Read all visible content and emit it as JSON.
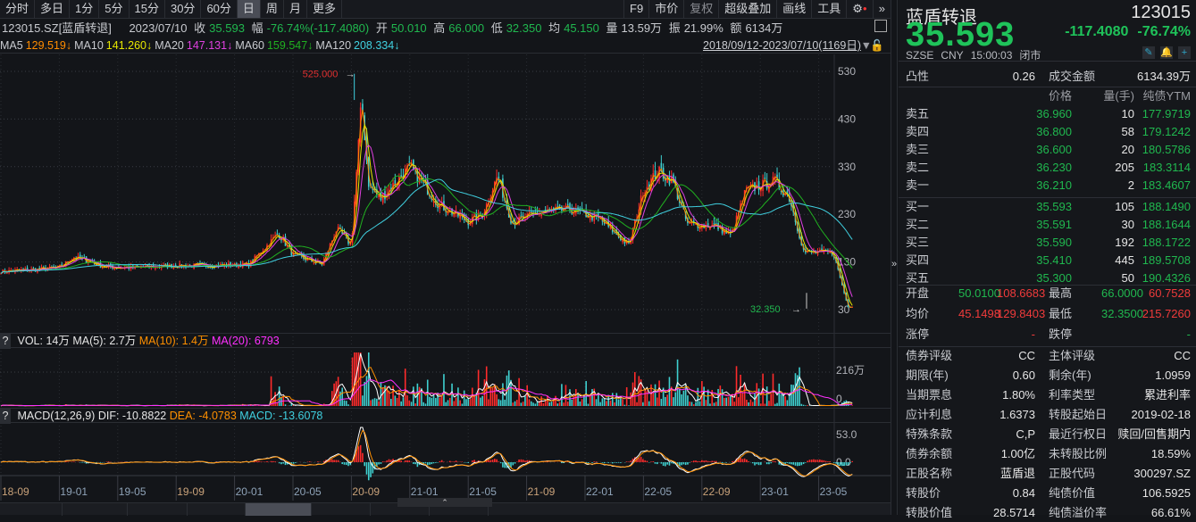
{
  "toolbar": {
    "periods": [
      "分时",
      "多日",
      "1分",
      "5分",
      "15分",
      "30分",
      "60分",
      "日",
      "周",
      "月",
      "更多"
    ],
    "active": "日",
    "right": [
      "F9",
      "市价",
      "复权",
      "超级叠加",
      "画线",
      "工具"
    ]
  },
  "info": {
    "code_name": "123015.SZ[蓝盾转退]",
    "date": "2023/07/10",
    "close_label": "收",
    "close": "35.593",
    "amp_label": "幅",
    "change": "-76.74%(-117.4080)",
    "open_label": "开",
    "open": "50.010",
    "high_label": "高",
    "high": "66.000",
    "low_label": "低",
    "low": "32.350",
    "avg_label": "均",
    "avg": "45.150",
    "vol_label": "量",
    "vol": "13.59万",
    "swing_label": "振",
    "swing": "21.99%",
    "amt_label": "额",
    "amt": "6134万"
  },
  "ma": [
    {
      "label": "MA5",
      "value": "129.519↓",
      "color": "#ff8c00"
    },
    {
      "label": "MA10",
      "value": "141.260↓",
      "color": "#e6e600"
    },
    {
      "label": "MA20",
      "value": "147.131↓",
      "color": "#e040e0"
    },
    {
      "label": "MA60",
      "value": "159.547↓",
      "color": "#20b020"
    },
    {
      "label": "MA120",
      "value": "208.334↓",
      "color": "#40d0e0"
    }
  ],
  "range": "2018/09/12-2023/07/10(1169日)",
  "chart_data": {
    "type": "candlestick",
    "price_axis": {
      "ticks": [
        "530",
        "430",
        "330",
        "230",
        "130",
        "30"
      ],
      "range": [
        0,
        560
      ]
    },
    "max_label": "525.000",
    "min_label": "32.350",
    "close_path": [
      [
        "2018-09",
        110
      ],
      [
        "2018-11",
        113
      ],
      [
        "2019-01",
        118
      ],
      [
        "2019-02",
        140
      ],
      [
        "2019-03",
        132
      ],
      [
        "2019-04",
        120
      ],
      [
        "2019-06",
        118
      ],
      [
        "2019-09",
        122
      ],
      [
        "2019-12",
        123
      ],
      [
        "2020-02",
        125
      ],
      [
        "2020-04",
        190
      ],
      [
        "2020-05",
        145
      ],
      [
        "2020-07",
        125
      ],
      [
        "2020-08",
        200
      ],
      [
        "2020-09",
        165
      ],
      [
        "2020-09",
        470
      ],
      [
        "2020-10",
        290
      ],
      [
        "2020-11",
        262
      ],
      [
        "2021-01",
        330
      ],
      [
        "2021-03",
        250
      ],
      [
        "2021-05",
        215
      ],
      [
        "2021-06",
        230
      ],
      [
        "2021-07",
        310
      ],
      [
        "2021-08",
        212
      ],
      [
        "2021-10",
        235
      ],
      [
        "2021-12",
        240
      ],
      [
        "2022-02",
        220
      ],
      [
        "2022-04",
        165
      ],
      [
        "2022-05",
        280
      ],
      [
        "2022-06",
        320
      ],
      [
        "2022-07",
        300
      ],
      [
        "2022-08",
        210
      ],
      [
        "2022-10",
        205
      ],
      [
        "2022-11",
        185
      ],
      [
        "2022-12",
        280
      ],
      [
        "2023-01",
        290
      ],
      [
        "2023-02",
        300
      ],
      [
        "2023-03",
        265
      ],
      [
        "2023-04",
        150
      ],
      [
        "2023-06",
        150
      ],
      [
        "2023-07",
        36
      ]
    ],
    "x_ticks": [
      "18-09",
      "19-01",
      "19-05",
      "19-09",
      "20-01",
      "20-05",
      "20-09",
      "21-01",
      "21-05",
      "21-09",
      "22-01",
      "22-05",
      "22-09",
      "23-01",
      "23-05"
    ],
    "vol": {
      "title": "VOL: 14万",
      "ma5": "MA(5): 2.7万",
      "ma10": "MA(10): 1.4万",
      "ma20": "MA(20): 6793",
      "ticks": [
        "216万",
        "0"
      ]
    },
    "macd": {
      "title": "MACD(12,26,9)",
      "dif": "DIF: -10.8822",
      "dea": "DEA: -4.0783",
      "macd": "MACD: -13.6078",
      "ticks": [
        "53.0",
        "0.0"
      ]
    }
  },
  "quote": {
    "name": "蓝盾转退",
    "code": "123015",
    "price": "35.593",
    "change": "-117.4080",
    "pct": "-76.74%",
    "exchange": "SZSE",
    "currency": "CNY",
    "time": "15:00:03",
    "status": "闭市"
  },
  "stats1": {
    "convexity_label": "凸性",
    "convexity": "0.26",
    "amount_label": "成交金额",
    "amount": "6134.39万"
  },
  "ob_header": [
    "价格",
    "量(手)",
    "纯债YTM"
  ],
  "orderbook": [
    {
      "label": "卖五",
      "price": "36.960",
      "vol": "10",
      "ytm": "177.9719"
    },
    {
      "label": "卖四",
      "price": "36.800",
      "vol": "58",
      "ytm": "179.1242"
    },
    {
      "label": "卖三",
      "price": "36.600",
      "vol": "20",
      "ytm": "180.5786"
    },
    {
      "label": "卖二",
      "price": "36.230",
      "vol": "205",
      "ytm": "183.3114"
    },
    {
      "label": "卖一",
      "price": "36.210",
      "vol": "2",
      "ytm": "183.4607"
    },
    {
      "label": "买一",
      "price": "35.593",
      "vol": "105",
      "ytm": "188.1490"
    },
    {
      "label": "买二",
      "price": "35.591",
      "vol": "30",
      "ytm": "188.1644"
    },
    {
      "label": "买三",
      "price": "35.590",
      "vol": "192",
      "ytm": "188.1722"
    },
    {
      "label": "买四",
      "price": "35.410",
      "vol": "445",
      "ytm": "189.5708"
    },
    {
      "label": "买五",
      "price": "35.300",
      "vol": "50",
      "ytm": "190.4326"
    }
  ],
  "ohl": [
    {
      "l1": "开盘",
      "v1a": "50.0100",
      "v1b": "108.6683",
      "l2": "最高",
      "v2a": "66.0000",
      "v2b": "60.7528"
    },
    {
      "l1": "均价",
      "v1a": "45.1498",
      "v1b": "129.8403",
      "l2": "最低",
      "v2a": "32.3500",
      "v2b": "215.7260"
    }
  ],
  "limits": {
    "up_label": "涨停",
    "up": "-",
    "down_label": "跌停",
    "down": "-"
  },
  "bond": [
    [
      "债券评级",
      "CC",
      "主体评级",
      "CC"
    ],
    [
      "期限(年)",
      "0.60",
      "剩余(年)",
      "1.0959"
    ],
    [
      "当期票息",
      "1.80%",
      "利率类型",
      "累进利率"
    ],
    [
      "应计利息",
      "1.6373",
      "转股起始日",
      "2019-02-18"
    ],
    [
      "特殊条款",
      "C,P",
      "最近行权日",
      "赎回/回售期内"
    ],
    [
      "债券余额",
      "1.00亿",
      "未转股比例",
      "18.59%"
    ],
    [
      "正股名称",
      "蓝盾退",
      "正股代码",
      "300297.SZ"
    ],
    [
      "转股价",
      "0.84",
      "纯债价值",
      "106.5925"
    ],
    [
      "转股价值",
      "28.5714",
      "纯债溢价率",
      "66.61%"
    ]
  ]
}
